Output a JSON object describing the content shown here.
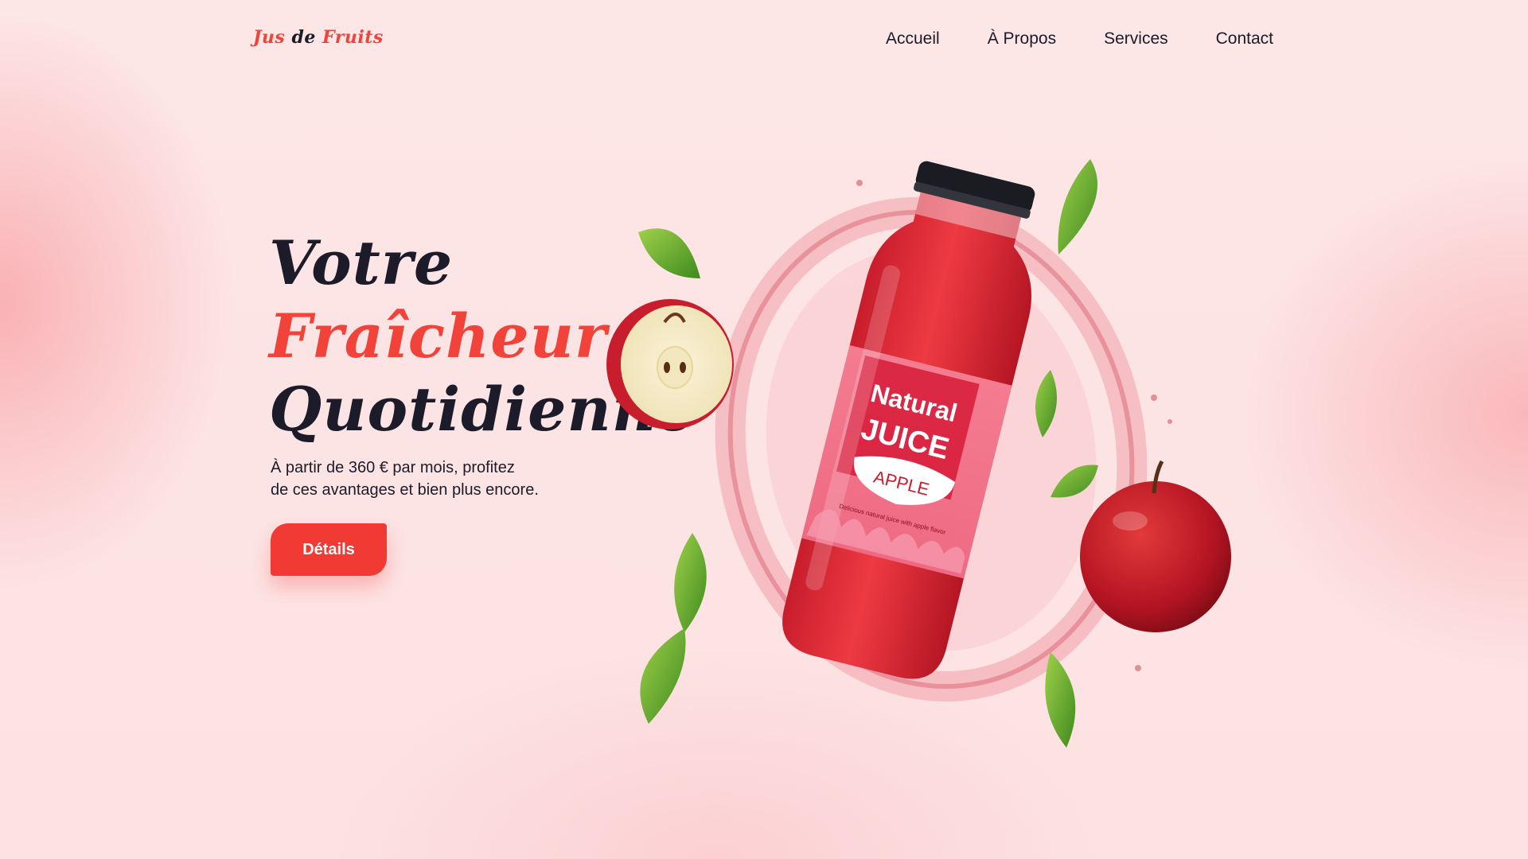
{
  "header": {
    "logo": {
      "word1": "Jus",
      "word2": "de",
      "word3": "Fruits"
    },
    "nav": [
      "Accueil",
      "À Propos",
      "Services",
      "Contact"
    ]
  },
  "hero": {
    "title_line1": "Votre",
    "title_line2": "Fraîcheur",
    "title_line3": "Quotidienne",
    "subtitle_line1": "À partir de 360 € par mois, profitez",
    "subtitle_line2": "de ces avantages et bien plus encore.",
    "cta_label": "Détails"
  },
  "product": {
    "label_line1": "Natural",
    "label_line2": "JUICE",
    "flavor": "APPLE",
    "tagline": "Delicious natural juice with apple flavor"
  },
  "colors": {
    "accent": "#f2433a",
    "text_dark": "#1c1b2a",
    "background": "#fde3e3",
    "juice": "#e8303c"
  }
}
